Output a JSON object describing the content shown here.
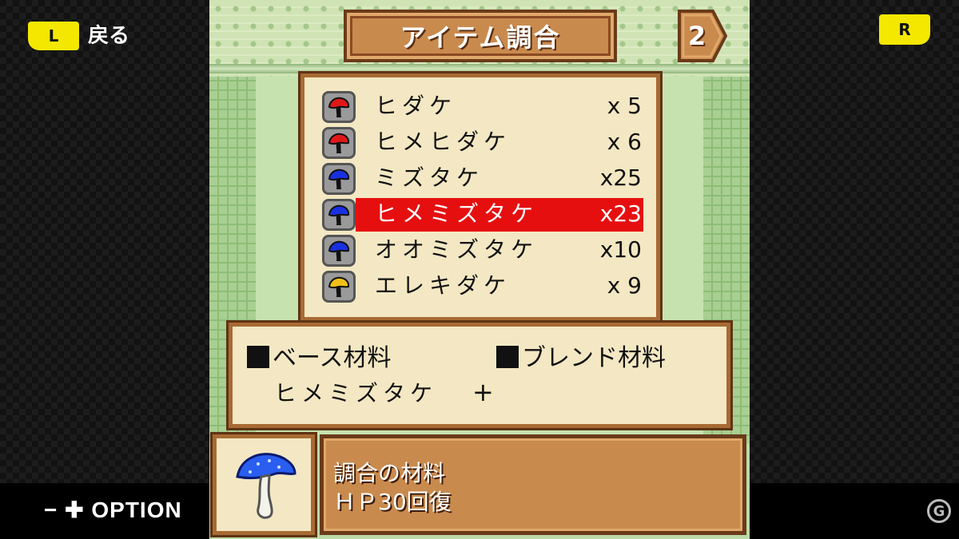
{
  "controls": {
    "l_button": "L",
    "back_label": "戻る",
    "r_button": "R",
    "option_label": "− ✚ OPTION",
    "logo_text": "G"
  },
  "screen": {
    "title": "アイテム調合",
    "page_number": "2"
  },
  "items": [
    {
      "name": "ヒダケ",
      "count": "x 5",
      "color": "#e01818",
      "selected": false
    },
    {
      "name": "ヒメヒダケ",
      "count": "x 6",
      "color": "#e01818",
      "selected": false
    },
    {
      "name": "ミズタケ",
      "count": "x25",
      "color": "#1830e0",
      "selected": false
    },
    {
      "name": "ヒメミズタケ",
      "count": "x23",
      "color": "#1830e0",
      "selected": true
    },
    {
      "name": "オオミズタケ",
      "count": "x10",
      "color": "#1830e0",
      "selected": false
    },
    {
      "name": "エレキダケ",
      "count": "x 9",
      "color": "#f0c018",
      "selected": false
    }
  ],
  "materials": {
    "base_label": "ベース材料",
    "blend_label": "ブレンド材料",
    "base_value": "ヒメミズタケ",
    "plus": "+"
  },
  "description": {
    "line1": "調合の材料",
    "line2": "ＨＰ30回復"
  },
  "colors": {
    "selection": "#e60f10",
    "panel": "#f3e8c3",
    "frame_brown": "#a86a34",
    "field_green": "#c6e2ae"
  }
}
